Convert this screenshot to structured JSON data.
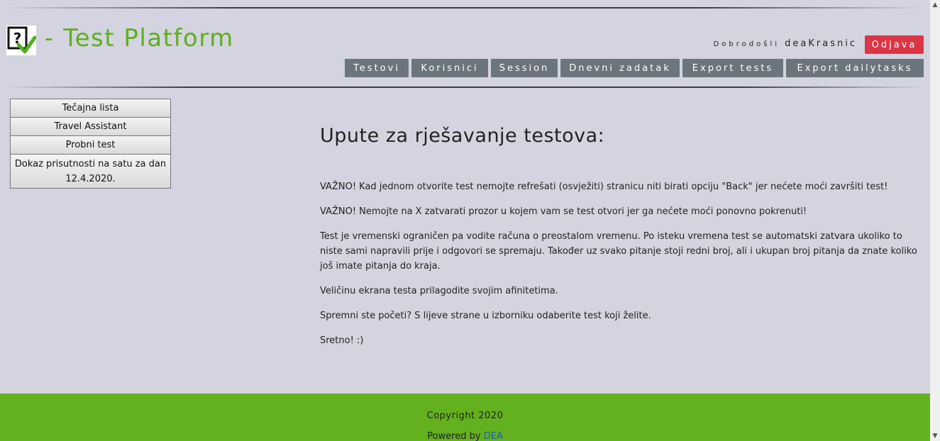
{
  "header": {
    "brand_title": "- Test Platform",
    "welcome_label": "Dobrodošli",
    "username": "deaKrasnic",
    "logout_label": "Odjava"
  },
  "nav": {
    "tabs": [
      {
        "label": "Testovi"
      },
      {
        "label": "Korisnici"
      },
      {
        "label": "Session"
      },
      {
        "label": "Dnevni zadatak"
      },
      {
        "label": "Export tests"
      },
      {
        "label": "Export dailytasks"
      }
    ]
  },
  "sidebar": {
    "items": [
      {
        "label": "Tečajna lista"
      },
      {
        "label": "Travel Assistant"
      },
      {
        "label": "Probni test"
      },
      {
        "label": "Dokaz prisutnosti na satu za dan 12.4.2020."
      }
    ]
  },
  "main": {
    "title": "Upute za rješavanje testova:",
    "paragraphs": [
      "VAŽNO! Kad jednom otvorite test nemojte refrešati (osvježiti) stranicu niti birati opciju \"Back\" jer nećete moći završiti test!",
      "VAŽNO! Nemojte na X zatvarati prozor u kojem vam se test otvori jer ga nećete moći ponovno pokrenuti!",
      "Test je vremenski ograničen pa vodite računa o preostalom vremenu. Po isteku vremena test se automatski zatvara ukoliko to niste sami napravili prije i odgovori se spremaju. Također uz svako pitanje stoji redni broj, ali i ukupan broj pitanja da znate koliko još imate pitanja do kraja.",
      "Veličinu ekrana testa prilagodite svojim afinitetima.",
      "Spremni ste početi? S lijeve strane u izborniku odaberite test koji želite.",
      "Sretno! :)"
    ]
  },
  "footer": {
    "copyright": "Copyright 2020",
    "powered_by": "Powered by",
    "powered_link": "DEA"
  },
  "colors": {
    "brand_green": "#5fae1e",
    "footer_green": "#63b11e",
    "logout_red": "#dc3545",
    "nav_gray": "#6c757d",
    "page_bg": "#d4d4e0"
  },
  "icons": {
    "logo": "question-check-icon",
    "scroll_up": "scroll-up-arrow-icon",
    "scroll_down": "scroll-down-arrow-icon"
  }
}
